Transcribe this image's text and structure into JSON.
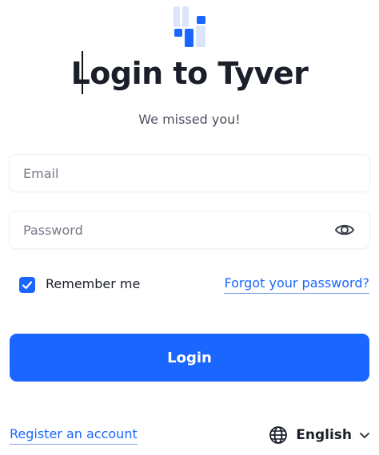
{
  "brand": {
    "accent_color": "#1a66ff",
    "logo_icon": "tyver-logo-icon"
  },
  "header": {
    "title": "Login to Tyver",
    "subtitle": "We missed you!"
  },
  "form": {
    "email_placeholder": "Email",
    "email_value": "",
    "password_placeholder": "Password",
    "password_value": "",
    "password_visibility_icon": "eye-icon",
    "remember_label": "Remember me",
    "remember_checked": true,
    "forgot_link": "Forgot your password?",
    "submit_label": "Login"
  },
  "footer": {
    "register_link": "Register an account",
    "language_icon": "globe-icon",
    "language_selected": "English",
    "language_dropdown_icon": "chevron-down-icon"
  }
}
